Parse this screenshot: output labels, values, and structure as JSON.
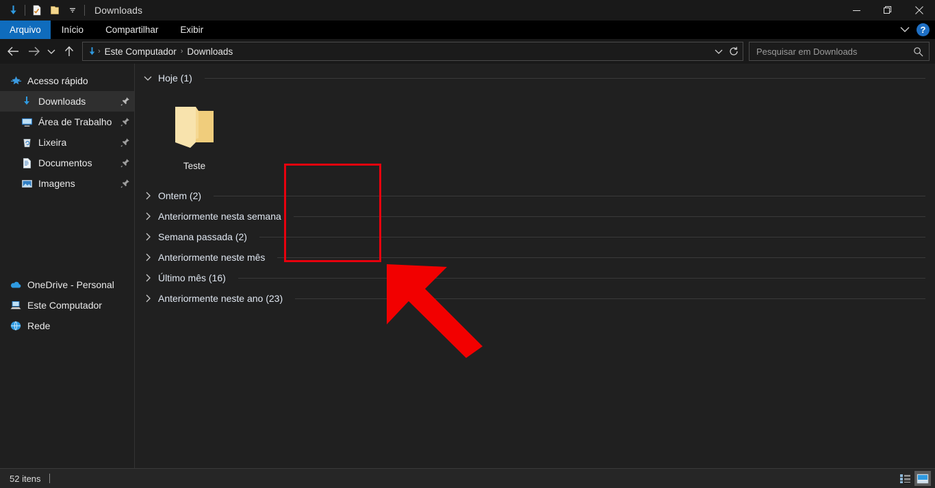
{
  "window": {
    "title": "Downloads",
    "quick_access": [
      {
        "name": "downloads-folder-icon",
        "label": "Downloads"
      },
      {
        "name": "properties-icon",
        "label": "Propriedades"
      },
      {
        "name": "new-folder-icon",
        "label": "Nova pasta"
      },
      {
        "name": "customize-qat-chevron-icon",
        "label": "Personalizar Barra de Ferramentas de Acesso Rápido"
      }
    ],
    "controls": {
      "minimize": "—",
      "maximize": "❐",
      "close": "✕"
    }
  },
  "ribbon": {
    "tabs": [
      {
        "label": "Arquivo",
        "active": true
      },
      {
        "label": "Início",
        "active": false
      },
      {
        "label": "Compartilhar",
        "active": false
      },
      {
        "label": "Exibir",
        "active": false
      }
    ],
    "expand_chevron": "⌄",
    "help_label": "?"
  },
  "navbar": {
    "back": "←",
    "forward": "→",
    "recent": "⌄",
    "up": "↑",
    "breadcrumbs": [
      {
        "label": "Este Computador"
      },
      {
        "label": "Downloads"
      }
    ],
    "separator": "›",
    "history_chevron": "⌄",
    "refresh": "↻"
  },
  "search": {
    "placeholder": "Pesquisar em Downloads",
    "value": ""
  },
  "sidebar": {
    "quick_access": {
      "label": "Acesso rápido",
      "items": [
        {
          "label": "Downloads",
          "icon": "download-arrow-icon",
          "pinned": true,
          "selected": true
        },
        {
          "label": "Área de Trabalho",
          "icon": "desktop-icon",
          "pinned": true,
          "selected": false
        },
        {
          "label": "Lixeira",
          "icon": "recycle-bin-icon",
          "pinned": true,
          "selected": false
        },
        {
          "label": "Documentos",
          "icon": "documents-icon",
          "pinned": true,
          "selected": false
        },
        {
          "label": "Imagens",
          "icon": "pictures-icon",
          "pinned": true,
          "selected": false
        }
      ]
    },
    "roots": [
      {
        "label": "OneDrive - Personal",
        "icon": "onedrive-cloud-icon"
      },
      {
        "label": "Este Computador",
        "icon": "this-pc-icon"
      },
      {
        "label": "Rede",
        "icon": "network-icon"
      }
    ]
  },
  "content": {
    "groups": [
      {
        "title": "Hoje (1)",
        "expanded": true,
        "items": [
          {
            "name": "Teste",
            "type": "folder",
            "highlighted": true
          }
        ]
      },
      {
        "title": "Ontem (2)",
        "expanded": false,
        "items": []
      },
      {
        "title": "Anteriormente nesta semana",
        "expanded": false,
        "items": []
      },
      {
        "title": "Semana passada (2)",
        "expanded": false,
        "items": []
      },
      {
        "title": "Anteriormente neste mês",
        "expanded": false,
        "items": []
      },
      {
        "title": "Último mês (16)",
        "expanded": false,
        "items": []
      },
      {
        "title": "Anteriormente neste ano (23)",
        "expanded": false,
        "items": []
      }
    ],
    "chevron_expanded": "⌄",
    "chevron_collapsed": "›"
  },
  "annotation": {
    "arrow_color": "#f20000",
    "highlight_color": "#e8000d"
  },
  "statusbar": {
    "item_count": "52 itens",
    "views": [
      {
        "name": "details-view-button",
        "active": false
      },
      {
        "name": "large-icons-view-button",
        "active": true
      }
    ]
  }
}
